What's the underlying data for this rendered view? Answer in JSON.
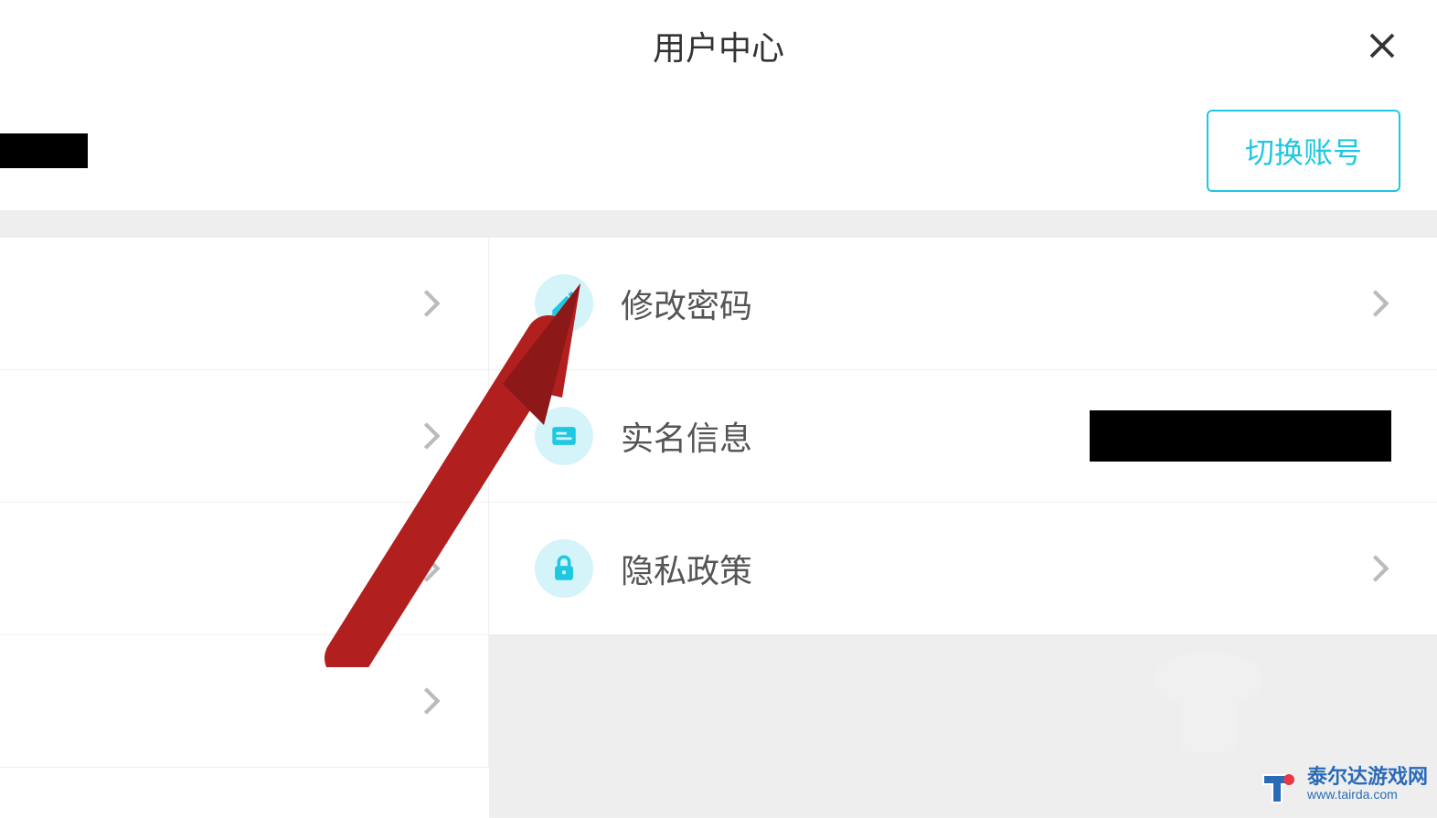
{
  "header": {
    "title": "用户中心"
  },
  "account": {
    "switch_label": "切换账号"
  },
  "menu": {
    "change_password": "修改密码",
    "real_name_info": "实名信息",
    "privacy_policy": "隐私政策"
  },
  "watermark": {
    "main": "泰尔达游戏网",
    "sub": "www.tairda.com"
  },
  "colors": {
    "accent": "#1ec8e0",
    "icon_bg": "#d4f4f9",
    "arrow": "#b1201f"
  }
}
